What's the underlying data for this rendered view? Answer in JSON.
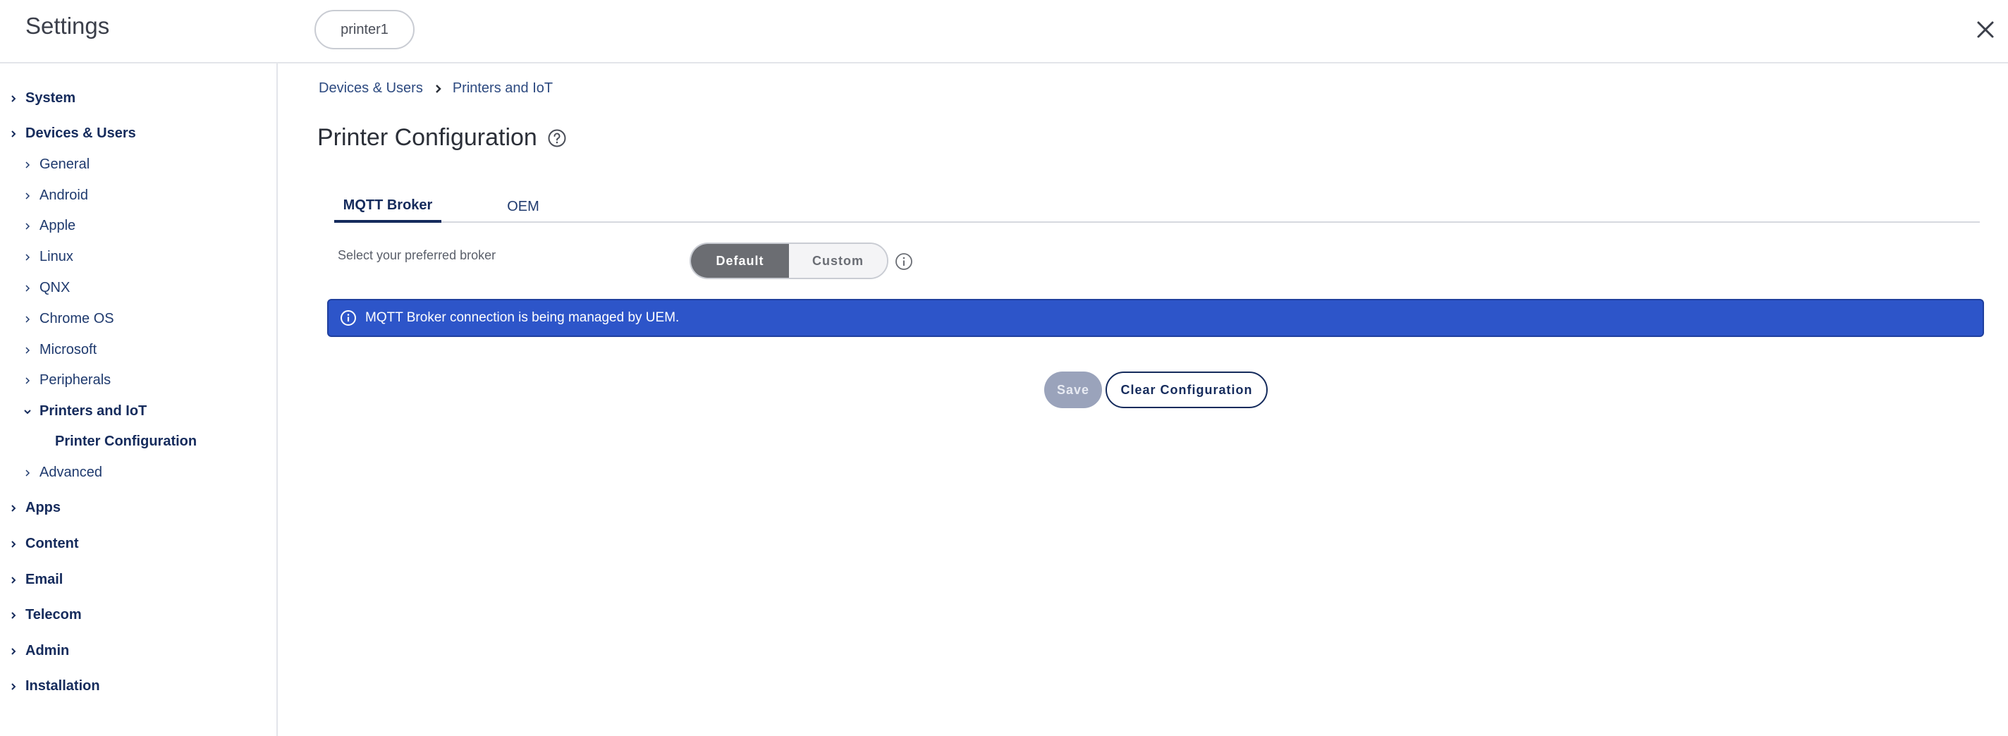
{
  "header": {
    "title": "Settings",
    "context_pill": "printer1",
    "close_icon": "close-icon"
  },
  "sidebar": {
    "items": [
      {
        "label": "System",
        "level": 1,
        "expanded": false
      },
      {
        "label": "Devices & Users",
        "level": 1,
        "expanded": true
      },
      {
        "label": "General",
        "level": 2,
        "expanded": false
      },
      {
        "label": "Android",
        "level": 2,
        "expanded": false
      },
      {
        "label": "Apple",
        "level": 2,
        "expanded": false
      },
      {
        "label": "Linux",
        "level": 2,
        "expanded": false
      },
      {
        "label": "QNX",
        "level": 2,
        "expanded": false
      },
      {
        "label": "Chrome OS",
        "level": 2,
        "expanded": false
      },
      {
        "label": "Microsoft",
        "level": 2,
        "expanded": false
      },
      {
        "label": "Peripherals",
        "level": 2,
        "expanded": false
      },
      {
        "label": "Printers and IoT",
        "level": 2,
        "expanded": true
      },
      {
        "label": "Printer Configuration",
        "level": 3,
        "selected": true
      },
      {
        "label": "Advanced",
        "level": 2,
        "expanded": false
      },
      {
        "label": "Apps",
        "level": 1,
        "expanded": false
      },
      {
        "label": "Content",
        "level": 1,
        "expanded": false
      },
      {
        "label": "Email",
        "level": 1,
        "expanded": false
      },
      {
        "label": "Telecom",
        "level": 1,
        "expanded": false
      },
      {
        "label": "Admin",
        "level": 1,
        "expanded": false
      },
      {
        "label": "Installation",
        "level": 1,
        "expanded": false
      }
    ]
  },
  "breadcrumb": {
    "items": [
      "Devices & Users",
      "Printers and IoT"
    ]
  },
  "main": {
    "page_title": "Printer Configuration",
    "tabs": [
      {
        "label": "MQTT Broker",
        "active": true
      },
      {
        "label": "OEM",
        "active": false
      }
    ],
    "broker_label": "Select your preferred broker",
    "broker_options": [
      "Default",
      "Custom"
    ],
    "broker_selected": "Default",
    "banner_text": "MQTT Broker connection is being managed by UEM.",
    "save_label": "Save",
    "clear_label": "Clear Configuration"
  },
  "colors": {
    "accent_navy": "#152b5c",
    "banner_blue": "#2d55c9",
    "segment_selected": "#6b6d72",
    "save_disabled": "#9aa3bb"
  }
}
